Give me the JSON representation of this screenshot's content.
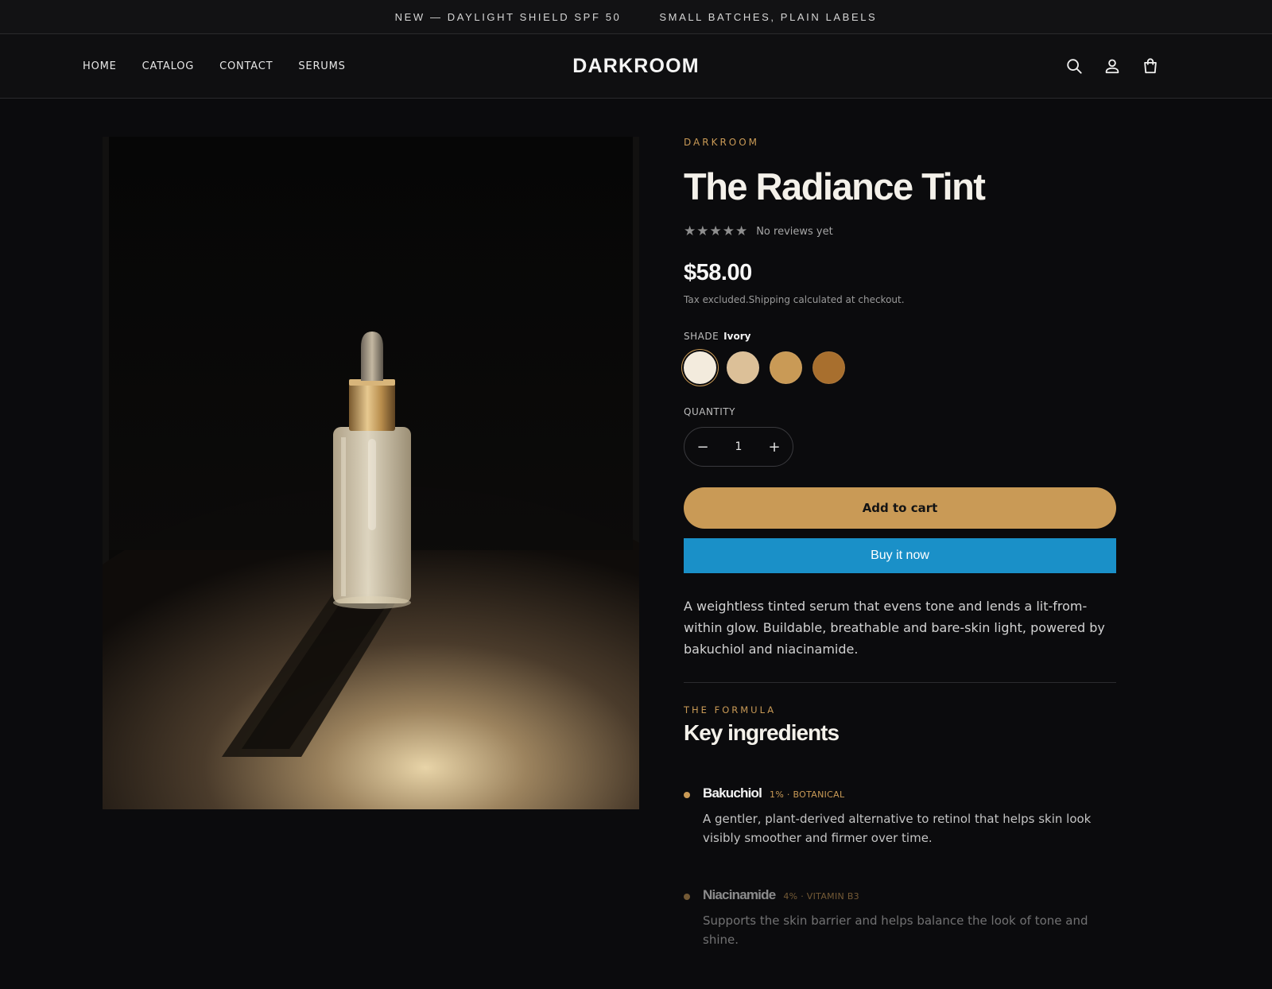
{
  "announcement": {
    "items": [
      "NEW — DAYLIGHT SHIELD SPF 50",
      "SMALL BATCHES, PLAIN LABELS"
    ]
  },
  "header": {
    "nav": [
      "HOME",
      "CATALOG",
      "CONTACT",
      "SERUMS"
    ],
    "logo": "DARKROOM",
    "icons": [
      "search-icon",
      "account-icon",
      "cart-icon"
    ]
  },
  "product": {
    "vendor": "DARKROOM",
    "title": "The Radiance Tint",
    "stars": "★★★★★",
    "rating_text": "No reviews yet",
    "price": "$58.00",
    "tax_note": "Tax excluded.Shipping calculated at checkout.",
    "shade_label": "SHADE",
    "shade_selected": "Ivory",
    "swatches": [
      "#f3ebdd",
      "#dcc098",
      "#c99a56",
      "#a86f2e"
    ],
    "quantity_label": "QUANTITY",
    "quantity": "1",
    "add_to_cart": "Add to cart",
    "buy_now": "Buy it now",
    "description": "A weightless tinted serum that evens tone and lends a lit-from-within glow. Buildable, breathable and bare-skin light, powered by bakuchiol and niacinamide."
  },
  "formula": {
    "eyebrow": "THE FORMULA",
    "title": "Key ingredients",
    "ingredients": [
      {
        "name": "Bakuchiol",
        "tag": "1% · BOTANICAL",
        "desc": "A gentler, plant-derived alternative to retinol that helps skin look visibly smoother and firmer over time."
      },
      {
        "name": "Niacinamide",
        "tag": "4% · VITAMIN B3",
        "desc": "Supports the skin barrier and helps balance the look of tone and shine."
      }
    ]
  },
  "colors": {
    "accent": "#c99a56",
    "buy_now": "#1a90c8",
    "background": "#0b0b0d"
  }
}
